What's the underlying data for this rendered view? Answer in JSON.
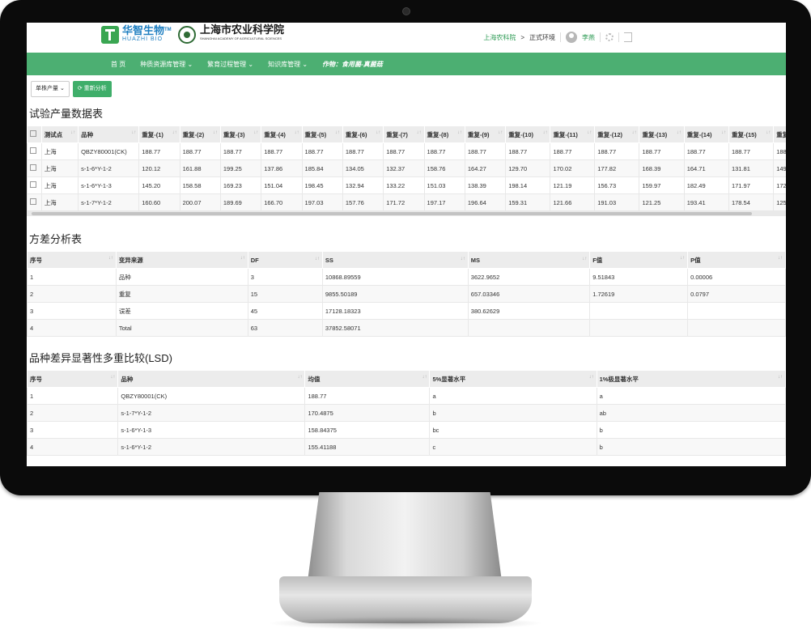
{
  "header": {
    "logo1_cn": "华智生物",
    "logo1_en": "HUAZHI BIO",
    "logo1_tm": "TM",
    "logo2_cn": "上海市农业科学院",
    "logo2_en": "SHANGHAI ACADEMY OF AGRICULTURAL SCIENCES",
    "org": "上海农科院",
    "separator": ">",
    "env": "正式环境",
    "user": "李燕"
  },
  "nav": {
    "items": [
      "首 页",
      "种质资源库管理 ⌄",
      "繁育过程管理 ⌄",
      "知识库管理 ⌄"
    ],
    "crop": "作物：食用菌-真菌菇"
  },
  "toolbar": {
    "select_label": "单株产量 ⌄",
    "analyze_label": "重新分析"
  },
  "yield_table": {
    "title": "试验产量数据表",
    "headers": [
      "测试点",
      "品种",
      "重复-(1)",
      "重复-(2)",
      "重复-(3)",
      "重复-(4)",
      "重复-(5)",
      "重复-(6)",
      "重复-(7)",
      "重复-(8)",
      "重复-(9)",
      "重复-(10)",
      "重复-(11)",
      "重复-(12)",
      "重复-(13)",
      "重复-(14)",
      "重复-(15)",
      "重复"
    ],
    "rows": [
      [
        "上海",
        "QBZY80001(CK)",
        "188.77",
        "188.77",
        "188.77",
        "188.77",
        "188.77",
        "188.77",
        "188.77",
        "188.77",
        "188.77",
        "188.77",
        "188.77",
        "188.77",
        "188.77",
        "188.77",
        "188.77",
        "188."
      ],
      [
        "上海",
        "s-1-6*Y-1-2",
        "120.12",
        "161.88",
        "199.25",
        "137.86",
        "185.84",
        "134.05",
        "132.37",
        "158.76",
        "164.27",
        "129.70",
        "170.02",
        "177.82",
        "168.39",
        "164.71",
        "131.81",
        "149."
      ],
      [
        "上海",
        "s-1-6*Y-1-3",
        "145.20",
        "158.58",
        "169.23",
        "151.04",
        "198.45",
        "132.94",
        "133.22",
        "151.03",
        "138.39",
        "198.14",
        "121.19",
        "156.73",
        "159.97",
        "182.49",
        "171.97",
        "172."
      ],
      [
        "上海",
        "s-1-7*Y-1-2",
        "160.60",
        "200.07",
        "189.69",
        "166.70",
        "197.03",
        "157.76",
        "171.72",
        "197.17",
        "196.64",
        "159.31",
        "121.66",
        "191.03",
        "121.25",
        "193.41",
        "178.54",
        "125."
      ]
    ]
  },
  "anova_table": {
    "title": "方差分析表",
    "headers": [
      "序号",
      "变异来源",
      "DF",
      "SS",
      "MS",
      "F值",
      "P值"
    ],
    "rows": [
      [
        "1",
        "品种",
        "3",
        "10868.89559",
        "3622.9652",
        "9.51843",
        "0.00006"
      ],
      [
        "2",
        "重复",
        "15",
        "9855.50189",
        "657.03346",
        "1.72619",
        "0.0797"
      ],
      [
        "3",
        "误差",
        "45",
        "17128.18323",
        "380.62629",
        "",
        ""
      ],
      [
        "4",
        "Total",
        "63",
        "37852.58071",
        "",
        "",
        ""
      ]
    ]
  },
  "lsd_table": {
    "title": "品种差异显著性多重比较(LSD)",
    "headers": [
      "序号",
      "品种",
      "均值",
      "5%显著水平",
      "1%极显著水平"
    ],
    "rows": [
      [
        "1",
        "QBZY80001(CK)",
        "188.77",
        "a",
        "a"
      ],
      [
        "2",
        "s-1-7*Y-1-2",
        "170.4875",
        "b",
        "ab"
      ],
      [
        "3",
        "s-1-6*Y-1-3",
        "158.84375",
        "bc",
        "b"
      ],
      [
        "4",
        "s-1-6*Y-1-2",
        "155.41188",
        "c",
        "b"
      ]
    ]
  }
}
